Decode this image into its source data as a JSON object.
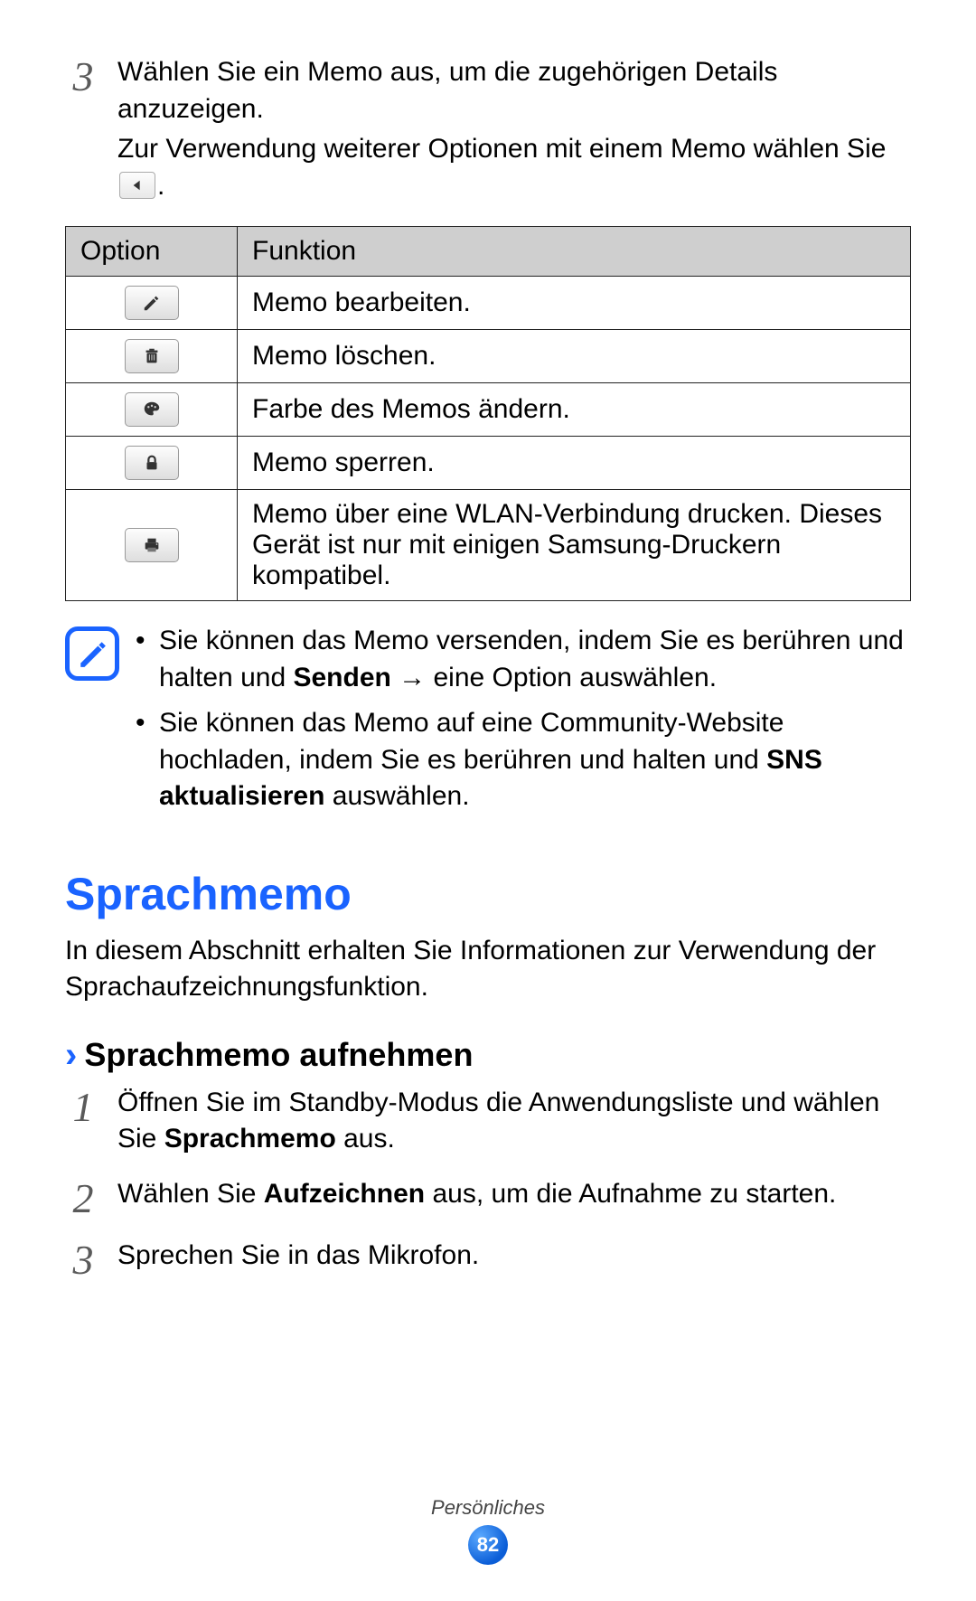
{
  "step3": {
    "num": "3",
    "line1": "Wählen Sie ein Memo aus, um die zugehörigen Details anzuzeigen.",
    "line2a": "Zur Verwendung weiterer Optionen mit einem Memo wählen Sie ",
    "line2b": "."
  },
  "table": {
    "head_option": "Option",
    "head_function": "Funktion",
    "rows": {
      "edit": "Memo bearbeiten.",
      "delete": "Memo löschen.",
      "color": "Farbe des Memos ändern.",
      "lock": "Memo sperren.",
      "print": "Memo über eine WLAN-Verbindung drucken. Dieses Gerät ist nur mit einigen Samsung-Druckern kompatibel."
    }
  },
  "note": {
    "item1a": "Sie können das Memo versenden, indem Sie es berühren und halten und ",
    "item1b": "Senden",
    "item1c": " → eine Option auswählen.",
    "item2a": "Sie können das Memo auf eine Community-Website hochladen, indem Sie es berühren und halten und ",
    "item2b": "SNS aktualisieren",
    "item2c": " auswählen."
  },
  "section": {
    "title": "Sprachmemo",
    "intro": "In diesem Abschnitt erhalten Sie Informationen zur Verwendung der Sprachaufzeichnungsfunktion."
  },
  "sub": {
    "title": "Sprachmemo aufnehmen"
  },
  "steps2": {
    "s1_num": "1",
    "s1a": "Öffnen Sie im Standby-Modus die Anwendungsliste und wählen Sie ",
    "s1b": "Sprachmemo",
    "s1c": " aus.",
    "s2_num": "2",
    "s2a": "Wählen Sie ",
    "s2b": "Aufzeichnen",
    "s2c": " aus, um die Aufnahme zu starten.",
    "s3_num": "3",
    "s3": "Sprechen Sie in das Mikrofon."
  },
  "footer": {
    "category": "Persönliches",
    "page": "82"
  }
}
